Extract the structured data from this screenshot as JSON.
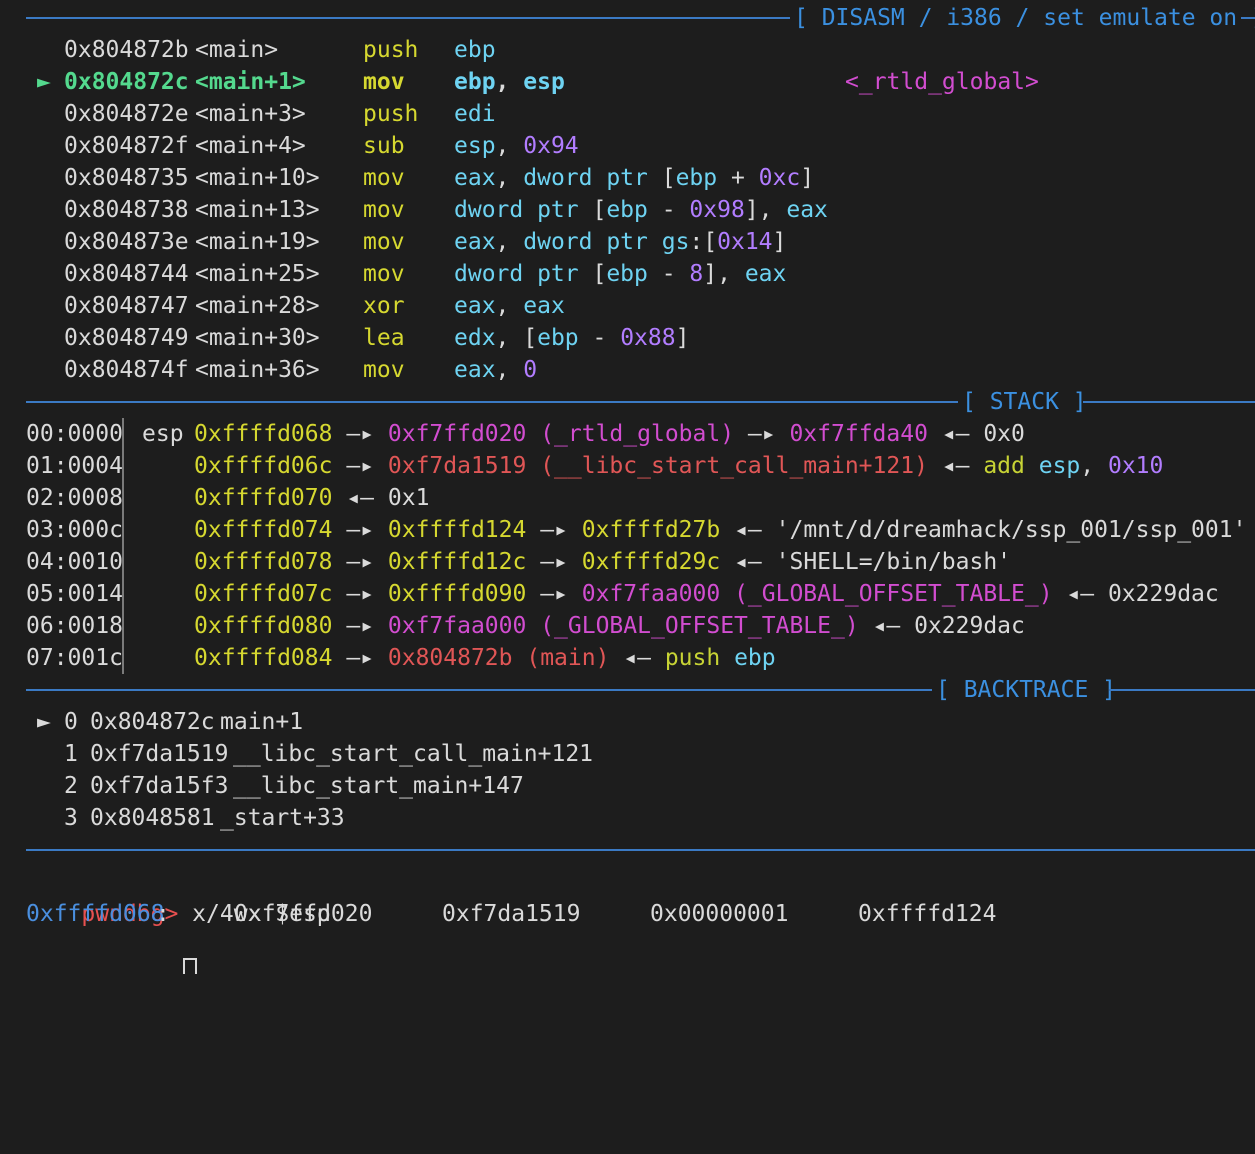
{
  "colors": {
    "background": "#1d1d1d",
    "separator": "#3b7ac4",
    "header_text": "#3b90e0",
    "address": "#dadada",
    "current_line": "#54d98e",
    "instruction": "#d6d830",
    "register": "#6ed3f2",
    "immediate": "#b27dff",
    "symbol_magenta": "#d24dd0",
    "symbol_red": "#e05656",
    "prompt": "#e85050"
  },
  "disasm": {
    "header": "[ DISASM / i386 / set emulate on ]",
    "marker": "►",
    "lines": [
      {
        "addr": "0x804872b",
        "sym": "<main>",
        "op": "push",
        "args": [
          {
            "t": "ebp",
            "c": "c-cyan"
          }
        ]
      },
      {
        "addr": "0x804872c",
        "sym": "<main+1>",
        "op": "mov",
        "current": true,
        "args": [
          {
            "t": "ebp",
            "c": "c-cyan"
          },
          {
            "t": ", ",
            "c": "c-white"
          },
          {
            "t": "esp",
            "c": "c-cyan"
          }
        ],
        "comment": "<_rtld_global>"
      },
      {
        "addr": "0x804872e",
        "sym": "<main+3>",
        "op": "push",
        "args": [
          {
            "t": "edi",
            "c": "c-cyan"
          }
        ]
      },
      {
        "addr": "0x804872f",
        "sym": "<main+4>",
        "op": "sub",
        "args": [
          {
            "t": "esp",
            "c": "c-cyan"
          },
          {
            "t": ", ",
            "c": "c-white"
          },
          {
            "t": "0x94",
            "c": "c-purple"
          }
        ]
      },
      {
        "addr": "0x8048735",
        "sym": "<main+10>",
        "op": "mov",
        "args": [
          {
            "t": "eax",
            "c": "c-cyan"
          },
          {
            "t": ", ",
            "c": "c-white"
          },
          {
            "t": "dword ptr",
            "c": "c-cyan"
          },
          {
            "t": " [",
            "c": "c-white"
          },
          {
            "t": "ebp",
            "c": "c-cyan"
          },
          {
            "t": " + ",
            "c": "c-white"
          },
          {
            "t": "0xc",
            "c": "c-purple"
          },
          {
            "t": "]",
            "c": "c-white"
          }
        ]
      },
      {
        "addr": "0x8048738",
        "sym": "<main+13>",
        "op": "mov",
        "args": [
          {
            "t": "dword ptr",
            "c": "c-cyan"
          },
          {
            "t": " [",
            "c": "c-white"
          },
          {
            "t": "ebp",
            "c": "c-cyan"
          },
          {
            "t": " - ",
            "c": "c-white"
          },
          {
            "t": "0x98",
            "c": "c-purple"
          },
          {
            "t": "], ",
            "c": "c-white"
          },
          {
            "t": "eax",
            "c": "c-cyan"
          }
        ]
      },
      {
        "addr": "0x804873e",
        "sym": "<main+19>",
        "op": "mov",
        "args": [
          {
            "t": "eax",
            "c": "c-cyan"
          },
          {
            "t": ", ",
            "c": "c-white"
          },
          {
            "t": "dword ptr gs",
            "c": "c-cyan"
          },
          {
            "t": ":[",
            "c": "c-white"
          },
          {
            "t": "0x14",
            "c": "c-purple"
          },
          {
            "t": "]",
            "c": "c-white"
          }
        ]
      },
      {
        "addr": "0x8048744",
        "sym": "<main+25>",
        "op": "mov",
        "args": [
          {
            "t": "dword ptr",
            "c": "c-cyan"
          },
          {
            "t": " [",
            "c": "c-white"
          },
          {
            "t": "ebp",
            "c": "c-cyan"
          },
          {
            "t": " - ",
            "c": "c-white"
          },
          {
            "t": "8",
            "c": "c-purple"
          },
          {
            "t": "], ",
            "c": "c-white"
          },
          {
            "t": "eax",
            "c": "c-cyan"
          }
        ]
      },
      {
        "addr": "0x8048747",
        "sym": "<main+28>",
        "op": "xor",
        "args": [
          {
            "t": "eax",
            "c": "c-cyan"
          },
          {
            "t": ", ",
            "c": "c-white"
          },
          {
            "t": "eax",
            "c": "c-cyan"
          }
        ]
      },
      {
        "addr": "0x8048749",
        "sym": "<main+30>",
        "op": "lea",
        "args": [
          {
            "t": "edx",
            "c": "c-cyan"
          },
          {
            "t": ", [",
            "c": "c-white"
          },
          {
            "t": "ebp",
            "c": "c-cyan"
          },
          {
            "t": " - ",
            "c": "c-white"
          },
          {
            "t": "0x88",
            "c": "c-purple"
          },
          {
            "t": "]",
            "c": "c-white"
          }
        ]
      },
      {
        "addr": "0x804874f",
        "sym": "<main+36>",
        "op": "mov",
        "args": [
          {
            "t": "eax",
            "c": "c-cyan"
          },
          {
            "t": ", ",
            "c": "c-white"
          },
          {
            "t": "0",
            "c": "c-purple"
          }
        ]
      }
    ]
  },
  "stack": {
    "header": "[ STACK ]",
    "rows": [
      {
        "off": "00:0000",
        "reg": "esp",
        "parts": [
          {
            "t": "0xffffd068",
            "c": "c-yellow"
          },
          {
            "t": " —▸ ",
            "c": "c-white"
          },
          {
            "t": "0xf7ffd020 (_rtld_global)",
            "c": "c-magenta"
          },
          {
            "t": " —▸ ",
            "c": "c-white"
          },
          {
            "t": "0xf7ffda40",
            "c": "c-magenta"
          },
          {
            "t": " ◂— ",
            "c": "c-white"
          },
          {
            "t": "0x0",
            "c": "c-white"
          }
        ]
      },
      {
        "off": "01:0004",
        "reg": "",
        "parts": [
          {
            "t": "0xffffd06c",
            "c": "c-yellow"
          },
          {
            "t": " —▸ ",
            "c": "c-white"
          },
          {
            "t": "0xf7da1519 (__libc_start_call_main+121)",
            "c": "c-red"
          },
          {
            "t": " ◂— ",
            "c": "c-white"
          },
          {
            "t": "add",
            "c": "c-yel2"
          },
          {
            "t": " ",
            "c": "c-white"
          },
          {
            "t": "esp",
            "c": "c-cyan"
          },
          {
            "t": ", ",
            "c": "c-white"
          },
          {
            "t": "0x10",
            "c": "c-purple"
          }
        ]
      },
      {
        "off": "02:0008",
        "reg": "",
        "parts": [
          {
            "t": "0xffffd070",
            "c": "c-yellow"
          },
          {
            "t": " ◂— ",
            "c": "c-white"
          },
          {
            "t": "0x1",
            "c": "c-white"
          }
        ]
      },
      {
        "off": "03:000c",
        "reg": "",
        "parts": [
          {
            "t": "0xffffd074",
            "c": "c-yellow"
          },
          {
            "t": " —▸ ",
            "c": "c-white"
          },
          {
            "t": "0xffffd124",
            "c": "c-yellow"
          },
          {
            "t": " —▸ ",
            "c": "c-white"
          },
          {
            "t": "0xffffd27b",
            "c": "c-yellow"
          },
          {
            "t": " ◂— ",
            "c": "c-white"
          },
          {
            "t": "'/mnt/d/dreamhack/ssp_001/ssp_001'",
            "c": "c-white"
          }
        ]
      },
      {
        "off": "04:0010",
        "reg": "",
        "parts": [
          {
            "t": "0xffffd078",
            "c": "c-yellow"
          },
          {
            "t": " —▸ ",
            "c": "c-white"
          },
          {
            "t": "0xffffd12c",
            "c": "c-yellow"
          },
          {
            "t": " —▸ ",
            "c": "c-white"
          },
          {
            "t": "0xffffd29c",
            "c": "c-yellow"
          },
          {
            "t": " ◂— ",
            "c": "c-white"
          },
          {
            "t": "'SHELL=/bin/bash'",
            "c": "c-white"
          }
        ]
      },
      {
        "off": "05:0014",
        "reg": "",
        "parts": [
          {
            "t": "0xffffd07c",
            "c": "c-yellow"
          },
          {
            "t": " —▸ ",
            "c": "c-white"
          },
          {
            "t": "0xffffd090",
            "c": "c-yellow"
          },
          {
            "t": " —▸ ",
            "c": "c-white"
          },
          {
            "t": "0xf7faa000 (_GLOBAL_OFFSET_TABLE_)",
            "c": "c-magenta"
          },
          {
            "t": " ◂— ",
            "c": "c-white"
          },
          {
            "t": "0x229dac",
            "c": "c-white"
          }
        ]
      },
      {
        "off": "06:0018",
        "reg": "",
        "parts": [
          {
            "t": "0xffffd080",
            "c": "c-yellow"
          },
          {
            "t": " —▸ ",
            "c": "c-white"
          },
          {
            "t": "0xf7faa000 (_GLOBAL_OFFSET_TABLE_)",
            "c": "c-magenta"
          },
          {
            "t": " ◂— ",
            "c": "c-white"
          },
          {
            "t": "0x229dac",
            "c": "c-white"
          }
        ]
      },
      {
        "off": "07:001c",
        "reg": "",
        "parts": [
          {
            "t": "0xffffd084",
            "c": "c-yellow"
          },
          {
            "t": " —▸ ",
            "c": "c-white"
          },
          {
            "t": "0x804872b (main)",
            "c": "c-red"
          },
          {
            "t": " ◂— ",
            "c": "c-white"
          },
          {
            "t": "push",
            "c": "c-yel2"
          },
          {
            "t": " ",
            "c": "c-white"
          },
          {
            "t": "ebp",
            "c": "c-cyan"
          }
        ]
      }
    ]
  },
  "backtrace": {
    "header": "[ BACKTRACE ]",
    "marker": "►",
    "frames": [
      {
        "idx": "0",
        "addr": "0x804872c",
        "func": "main+1"
      },
      {
        "idx": "1",
        "addr": "0xf7da1519",
        "func": "__libc_start_call_main+121"
      },
      {
        "idx": "2",
        "addr": "0xf7da15f3",
        "func": "__libc_start_main+147"
      },
      {
        "idx": "3",
        "addr": "0x8048581",
        "func": "_start+33"
      }
    ]
  },
  "console": {
    "prompt": "pwndbg>",
    "command": " x/4wx $esp",
    "output_addr": "0xffffd068",
    "output_colon": ":",
    "words": [
      "0xf7ffd020",
      "0xf7da1519",
      "0x00000001",
      "0xffffd124"
    ]
  }
}
